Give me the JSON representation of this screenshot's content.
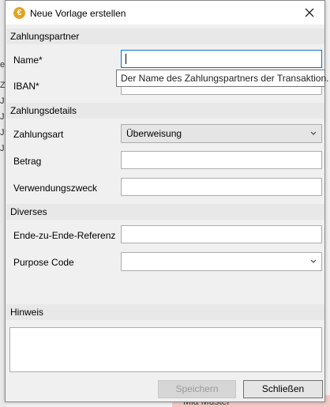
{
  "background": {
    "left_glyphs": [
      "e",
      "Z",
      "J",
      "J",
      "J",
      "J"
    ],
    "bottom_name": "Mia Muster"
  },
  "dialog": {
    "title": "Neue Vorlage erstellen",
    "icon_glyph": "€"
  },
  "sections": {
    "payee": "Zahlungspartner",
    "details": "Zahlungsdetails",
    "misc": "Diverses",
    "notes": "Hinweis"
  },
  "fields": {
    "name_label": "Name*",
    "name_value": "",
    "iban_label": "IBAN*",
    "iban_value": "",
    "payment_type_label": "Zahlungsart",
    "payment_type_value": "Überweisung",
    "amount_label": "Betrag",
    "amount_value": "",
    "purpose_label": "Verwendungszweck",
    "purpose_value": "",
    "e2e_label": "Ende-zu-Ende-Referenz",
    "e2e_value": "",
    "purpose_code_label": "Purpose Code",
    "purpose_code_value": ""
  },
  "tooltip": "Der Name des Zahlungspartners der Transaktion.",
  "buttons": {
    "save": "Speichern",
    "close": "Schließen"
  }
}
